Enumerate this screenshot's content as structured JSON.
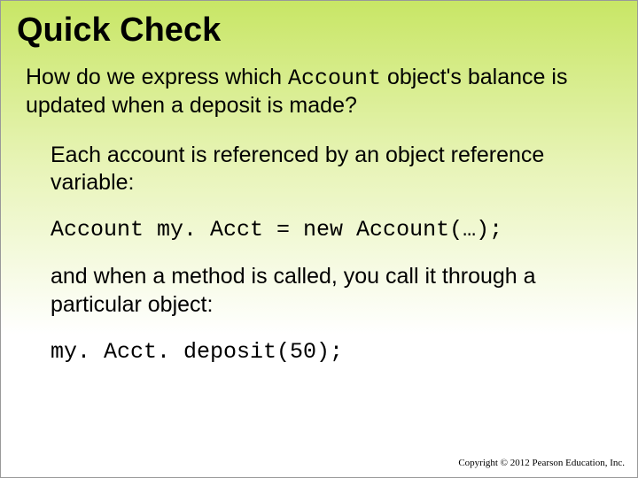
{
  "slide": {
    "title": "Quick Check",
    "question_pre": "How do we express which ",
    "question_code": "Account",
    "question_post": " object's balance is updated when a deposit is made?",
    "answer": {
      "p1": "Each account is referenced by an object reference variable:",
      "code1": "Account my. Acct = new Account(…);",
      "p2": "and when a method is called, you call it through a particular object:",
      "code2": "my. Acct. deposit(50);"
    },
    "copyright": "Copyright © 2012 Pearson Education, Inc."
  }
}
